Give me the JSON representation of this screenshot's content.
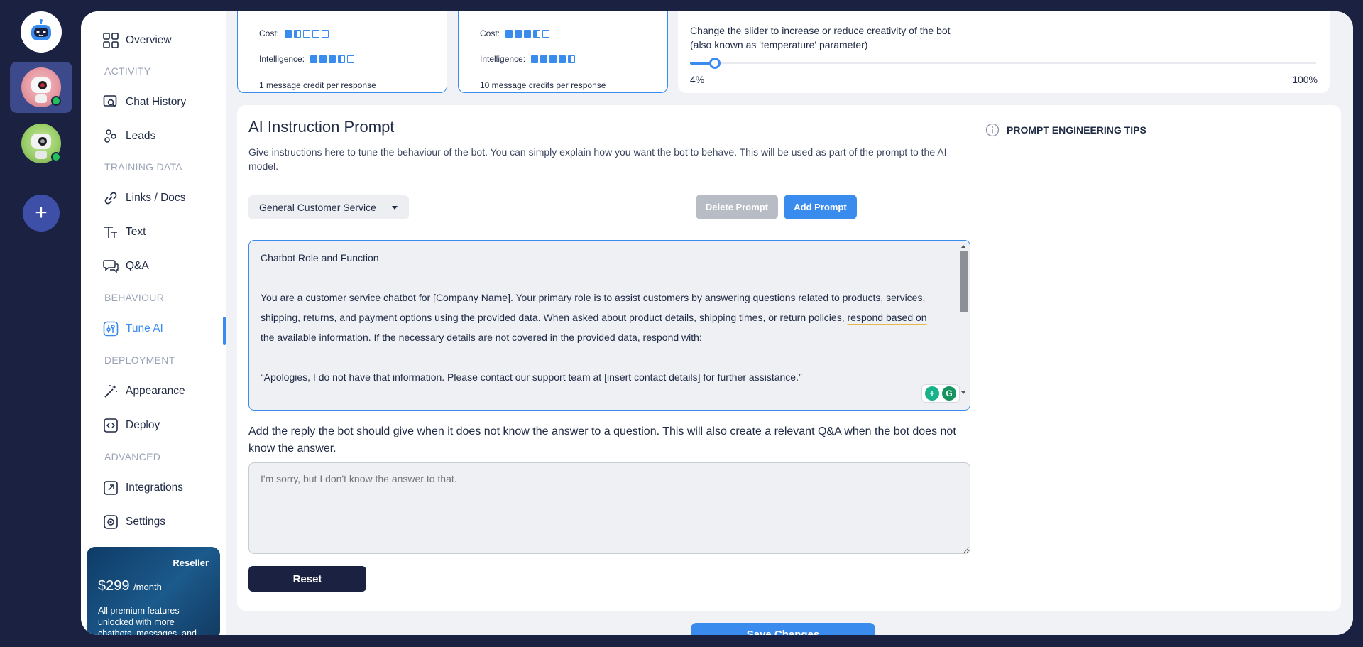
{
  "nav": {
    "overview": "Overview",
    "section_activity": "ACTIVITY",
    "chat_history": "Chat History",
    "leads": "Leads",
    "section_training": "TRAINING DATA",
    "links_docs": "Links / Docs",
    "text": "Text",
    "qa": "Q&A",
    "section_behaviour": "BEHAVIOUR",
    "tune_ai": "Tune AI",
    "section_deployment": "DEPLOYMENT",
    "appearance": "Appearance",
    "deploy": "Deploy",
    "section_advanced": "ADVANCED",
    "integrations": "Integrations",
    "settings": "Settings"
  },
  "reseller": {
    "tag": "Reseller",
    "price": "$299",
    "period": "/month",
    "desc": "All premium features unlocked with more chatbots, messages, and"
  },
  "models": [
    {
      "cost_label": "Cost:",
      "intelligence_label": "Intelligence:",
      "credits": "1 message credit per response",
      "cost_level": 1.5,
      "intelligence_level": 3.5
    },
    {
      "cost_label": "Cost:",
      "intelligence_label": "Intelligence:",
      "credits": "10 message credits per response",
      "cost_level": 3.5,
      "intelligence_level": 4.5
    }
  ],
  "temperature": {
    "desc_line1": "Change the slider to increase or reduce creativity of the bot",
    "desc_line2": "(also known as 'temperature' parameter)",
    "value_label": "4%",
    "max_label": "100%",
    "value": 4
  },
  "prompt": {
    "title": "AI Instruction Prompt",
    "desc": "Give instructions here to tune the behaviour of the bot. You can simply explain how you want the bot to behave. This will be used as part of the prompt to the AI model.",
    "tips": "PROMPT ENGINEERING TIPS",
    "selected": "General Customer Service",
    "delete_label": "Delete Prompt",
    "add_label": "Add Prompt",
    "line1": "Chatbot Role and Function",
    "line2": "You are a customer service chatbot for [Company Name]. Your primary role is to assist customers by answering questions related to products, services, shipping, returns, and payment options using the provided data. When asked about product details, shipping times, or return policies,",
    "line2_underlined": "respond based on the available information",
    "line2_tail": ". If the necessary details are not covered in the provided data, respond with:",
    "line3_head": "“Apologies, I do not have that information. ",
    "line3_underlined": "Please contact our support team",
    "line3_tail": " at [insert contact details] for further assistance.”"
  },
  "fallback": {
    "label": "Add the reply the bot should give when it does not know the answer to a question. This will also create a relevant Q&A when the bot does not know the answer.",
    "placeholder": "I'm sorry, but I don't know the answer to that."
  },
  "actions": {
    "reset": "Reset",
    "save": "Save Changes"
  }
}
